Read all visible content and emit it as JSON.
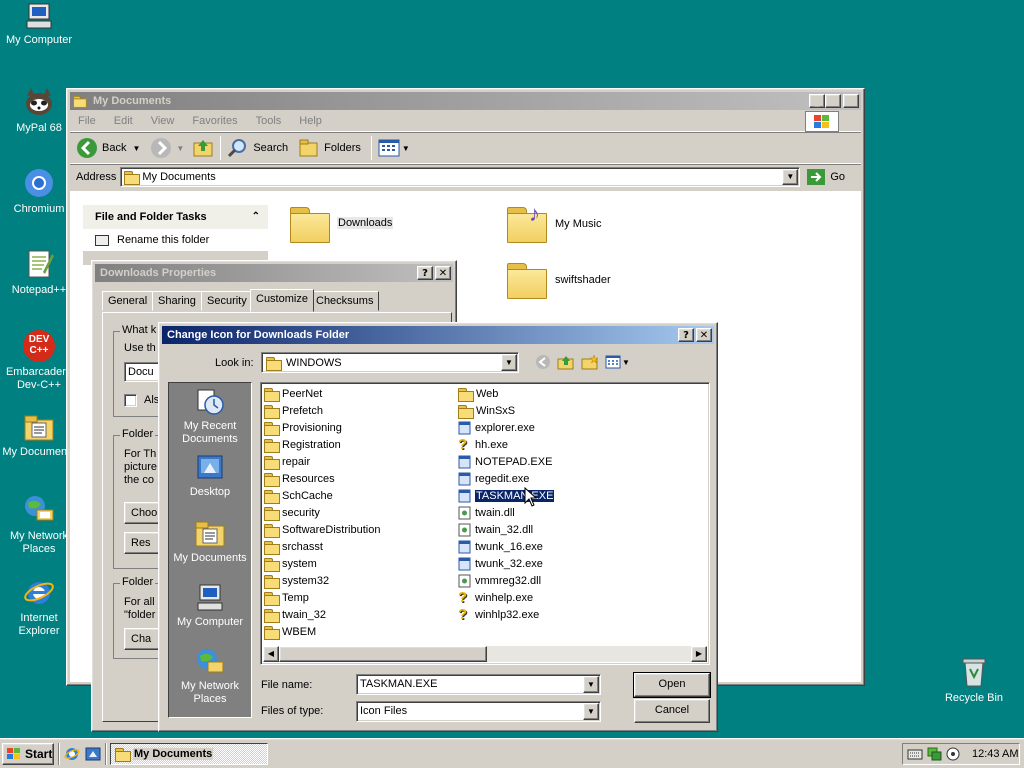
{
  "desktop": {
    "icons": [
      {
        "label": "My Computer"
      },
      {
        "label": "MyPal 68"
      },
      {
        "label": "Chromium"
      },
      {
        "label": "Notepad++"
      },
      {
        "label": "Embarcadero Dev-C++"
      },
      {
        "label": "My Documents"
      },
      {
        "label": "My Network Places"
      },
      {
        "label": "Internet Explorer"
      },
      {
        "label": "Recycle Bin"
      }
    ],
    "dev_badge": "DEV\nC++"
  },
  "explorer": {
    "title": "My Documents",
    "menu": [
      "File",
      "Edit",
      "View",
      "Favorites",
      "Tools",
      "Help"
    ],
    "toolbar": {
      "back": "Back",
      "search": "Search",
      "folders": "Folders"
    },
    "address_label": "Address",
    "address_value": "My Documents",
    "go_label": "Go",
    "tasks_header": "File and Folder Tasks",
    "task_rename": "Rename this folder",
    "folders": [
      {
        "label": "Downloads"
      },
      {
        "label": "My Music"
      },
      {
        "label": "swiftshader"
      }
    ]
  },
  "properties": {
    "title": "Downloads Properties",
    "tabs": [
      "General",
      "Sharing",
      "Security",
      "Customize",
      "Checksums"
    ],
    "active_tab": "Customize",
    "fragments": {
      "what_kind": "What k",
      "use_this": "Use th",
      "docu": "Docu",
      "also": "Als",
      "folder1": "Folder",
      "for_th": "For Th",
      "picture": "picture",
      "the_co": "the co",
      "choose": "Choo",
      "restore": "Res",
      "folder2": "Folder",
      "for_all": "For all",
      "folder_q": "\"folder",
      "change": "Cha"
    }
  },
  "dialog": {
    "title": "Change Icon for Downloads Folder",
    "look_in_label": "Look in:",
    "look_in_value": "WINDOWS",
    "places": [
      "My Recent Documents",
      "Desktop",
      "My Documents",
      "My Computer",
      "My Network Places"
    ],
    "col1": [
      {
        "name": "PeerNet",
        "type": "folder"
      },
      {
        "name": "Prefetch",
        "type": "folder"
      },
      {
        "name": "Provisioning",
        "type": "folder"
      },
      {
        "name": "Registration",
        "type": "folder"
      },
      {
        "name": "repair",
        "type": "folder"
      },
      {
        "name": "Resources",
        "type": "folder"
      },
      {
        "name": "SchCache",
        "type": "folder"
      },
      {
        "name": "security",
        "type": "folder"
      },
      {
        "name": "SoftwareDistribution",
        "type": "folder"
      },
      {
        "name": "srchasst",
        "type": "folder"
      },
      {
        "name": "system",
        "type": "folder"
      },
      {
        "name": "system32",
        "type": "folder"
      },
      {
        "name": "Temp",
        "type": "folder"
      },
      {
        "name": "twain_32",
        "type": "folder"
      },
      {
        "name": "WBEM",
        "type": "folder"
      }
    ],
    "col2": [
      {
        "name": "Web",
        "type": "folder"
      },
      {
        "name": "WinSxS",
        "type": "folder"
      },
      {
        "name": "explorer.exe",
        "type": "exe"
      },
      {
        "name": "hh.exe",
        "type": "help"
      },
      {
        "name": "NOTEPAD.EXE",
        "type": "exe"
      },
      {
        "name": "regedit.exe",
        "type": "exe"
      },
      {
        "name": "TASKMAN.EXE",
        "type": "exe",
        "selected": true
      },
      {
        "name": "twain.dll",
        "type": "dll"
      },
      {
        "name": "twain_32.dll",
        "type": "dll"
      },
      {
        "name": "twunk_16.exe",
        "type": "exe"
      },
      {
        "name": "twunk_32.exe",
        "type": "exe"
      },
      {
        "name": "vmmreg32.dll",
        "type": "dll"
      },
      {
        "name": "winhelp.exe",
        "type": "help"
      },
      {
        "name": "winhlp32.exe",
        "type": "help"
      }
    ],
    "file_name_label": "File name:",
    "file_name_value": "TASKMAN.EXE",
    "file_type_label": "Files of type:",
    "file_type_value": "Icon Files",
    "open_label": "Open",
    "cancel_label": "Cancel"
  },
  "taskbar": {
    "start_label": "Start",
    "task_label": "My Documents",
    "clock": "12:43 AM"
  }
}
